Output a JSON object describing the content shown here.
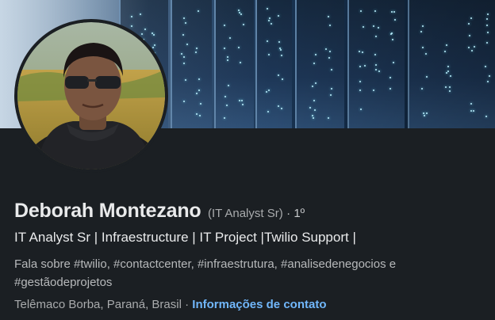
{
  "profile": {
    "name": "Deborah Montezano",
    "pronoun_note": "(IT Analyst Sr)",
    "degree": "· 1º",
    "headline": "IT Analyst Sr | Infraestructure | IT Project |Twilio Support |",
    "about_line1": "Fala sobre #twilio, #contactcenter, #infraestrutura, #analisedenegocios e",
    "about_line2": "#gestãodeprojetos",
    "location": "Telêmaco Borba, Paraná, Brasil",
    "separator": " · ",
    "contact_label": "Informações de contato"
  },
  "colors": {
    "background": "#1b1f23",
    "primary_text": "#e9eaeb",
    "secondary_text": "#a9abad",
    "link": "#71b7fb"
  },
  "icons": {
    "banner": "server-rack-banner-image",
    "avatar": "profile-photo"
  }
}
